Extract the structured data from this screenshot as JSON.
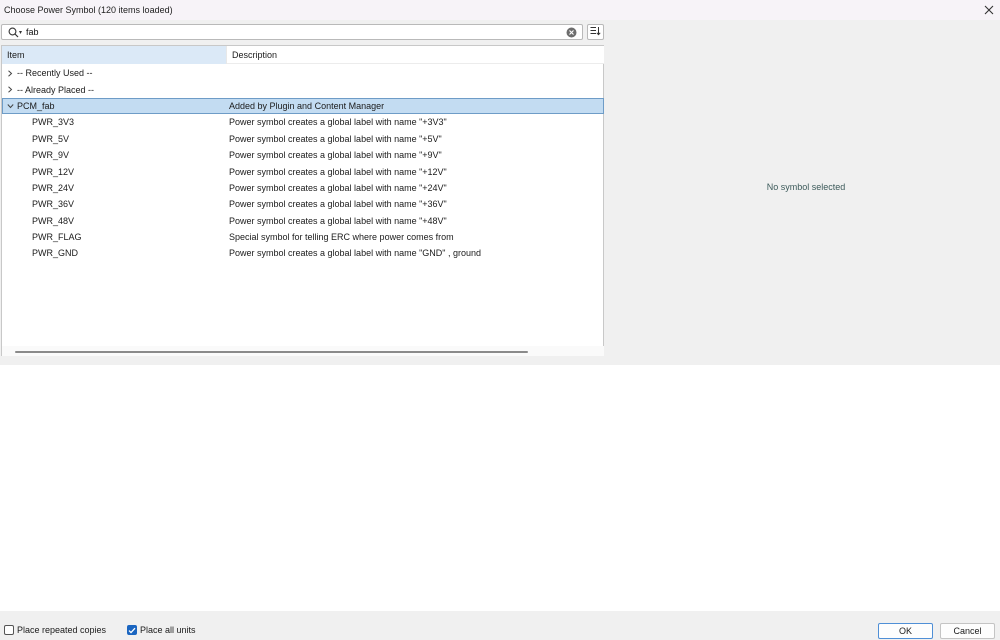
{
  "window": {
    "title": "Choose Power Symbol (120 items loaded)",
    "close_icon": "close-icon"
  },
  "search": {
    "value": "fab",
    "placeholder": "",
    "icon": "search-icon",
    "clear_icon": "clear-icon",
    "sort_icon": "sort-icon"
  },
  "tree": {
    "columns": [
      "Item",
      "Description"
    ],
    "rows": [
      {
        "name": "-- Recently Used --",
        "description": "",
        "kind": "group",
        "expanded": false
      },
      {
        "name": "-- Already Placed --",
        "description": "",
        "kind": "group",
        "expanded": false
      },
      {
        "name": "PCM_fab",
        "description": "Added by Plugin and Content Manager",
        "kind": "group",
        "expanded": true,
        "selected": true
      },
      {
        "name": "PWR_3V3",
        "description": "Power symbol creates a global label with name \"+3V3\"",
        "kind": "child"
      },
      {
        "name": "PWR_5V",
        "description": "Power symbol creates a global label with name \"+5V\"",
        "kind": "child"
      },
      {
        "name": "PWR_9V",
        "description": "Power symbol creates a global label with name \"+9V\"",
        "kind": "child"
      },
      {
        "name": "PWR_12V",
        "description": "Power symbol creates a global label with name \"+12V\"",
        "kind": "child"
      },
      {
        "name": "PWR_24V",
        "description": "Power symbol creates a global label with name \"+24V\"",
        "kind": "child"
      },
      {
        "name": "PWR_36V",
        "description": "Power symbol creates a global label with name \"+36V\"",
        "kind": "child"
      },
      {
        "name": "PWR_48V",
        "description": "Power symbol creates a global label with name \"+48V\"",
        "kind": "child"
      },
      {
        "name": "PWR_FLAG",
        "description": "Special symbol for telling ERC where power comes from",
        "kind": "child"
      },
      {
        "name": "PWR_GND",
        "description": "Power symbol creates a global label with name \"GND\" , ground",
        "kind": "child"
      }
    ]
  },
  "preview": {
    "message": "No symbol selected"
  },
  "footer": {
    "place_repeated_copies": {
      "label": "Place repeated copies",
      "checked": false
    },
    "place_all_units": {
      "label": "Place all units",
      "checked": true
    },
    "ok_label": "OK",
    "cancel_label": "Cancel"
  },
  "colors": {
    "selection": "#c3dcf2",
    "accent": "#1a65c0",
    "header_highlight": "#dbe9f7"
  }
}
